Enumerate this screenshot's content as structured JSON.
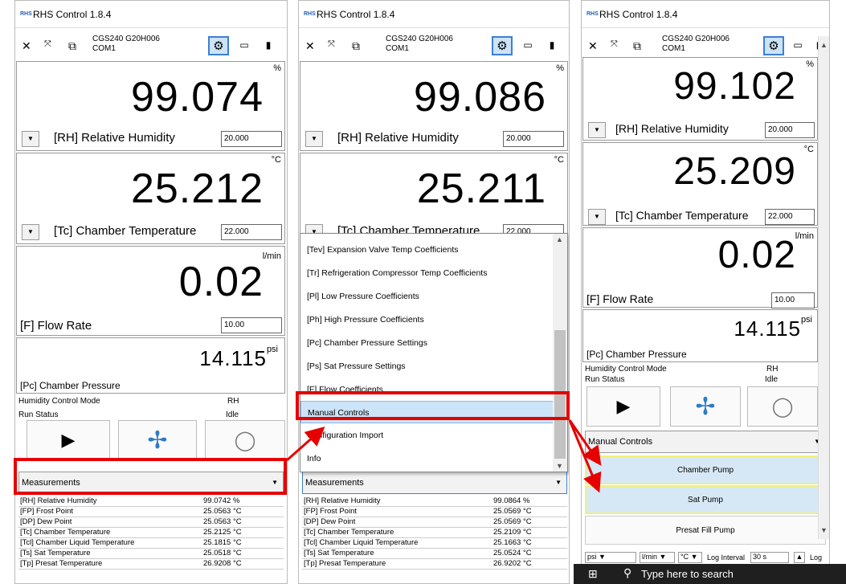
{
  "app": {
    "title": "RHS Control 1.8.4",
    "icon_text": "RHS"
  },
  "device": {
    "name": "CGS240 G20H006",
    "port": "COM1"
  },
  "windows": [
    {
      "rh": {
        "value": "99.074",
        "unit": "%",
        "label": "[RH] Relative Humidity",
        "setpoint": "20.000"
      },
      "tc": {
        "value": "25.212",
        "unit": "°C",
        "label": "[Tc] Chamber Temperature",
        "setpoint": "22.000"
      },
      "flow": {
        "value": "0.02",
        "unit": "l/min",
        "label": "[F] Flow Rate",
        "setpoint": "10.00"
      },
      "pc": {
        "value": "14.115",
        "unit": "psi",
        "label": "[Pc] Chamber Pressure"
      },
      "status": {
        "mode_label": "Humidity Control Mode",
        "mode_value": "RH",
        "run_label": "Run Status",
        "run_value": "Idle"
      },
      "combo": "Measurements",
      "measurements": [
        {
          "name": "[RH] Relative Humidity",
          "value": "99.0742 %"
        },
        {
          "name": "[FP] Frost Point",
          "value": "25.0563 °C"
        },
        {
          "name": "[DP] Dew Point",
          "value": "25.0563 °C"
        },
        {
          "name": "[Tc] Chamber Temperature",
          "value": "25.2125 °C"
        },
        {
          "name": "[Tcl] Chamber Liquid Temperature",
          "value": "25.1815 °C"
        },
        {
          "name": "[Ts] Sat Temperature",
          "value": "25.0518 °C"
        },
        {
          "name": "[Tp] Presat Temperature",
          "value": "26.9208 °C"
        }
      ]
    },
    {
      "rh": {
        "value": "99.086",
        "unit": "%",
        "label": "[RH] Relative Humidity",
        "setpoint": "20.000"
      },
      "tc": {
        "value": "25.211",
        "unit": "°C",
        "label": "[Tc] Chamber Temperature",
        "setpoint": "22.000"
      },
      "combo": "Measurements",
      "menu": [
        "[Tev] Expansion Valve Temp Coefficients",
        "[Tr] Refrigeration Compressor Temp Coefficients",
        "[Pl] Low Pressure Coefficients",
        "[Ph] High Pressure Coefficients",
        "[Pc] Chamber Pressure Settings",
        "[Ps] Sat Pressure Settings",
        "[F] Flow Coefficients",
        "Manual Controls",
        "Configuration Import",
        "Info"
      ],
      "measurements": [
        {
          "name": "[RH] Relative Humidity",
          "value": "99.0864 %"
        },
        {
          "name": "[FP] Frost Point",
          "value": "25.0569 °C"
        },
        {
          "name": "[DP] Dew Point",
          "value": "25.0569 °C"
        },
        {
          "name": "[Tc] Chamber Temperature",
          "value": "25.2109 °C"
        },
        {
          "name": "[Tcl] Chamber Liquid Temperature",
          "value": "25.1663 °C"
        },
        {
          "name": "[Ts] Sat Temperature",
          "value": "25.0524 °C"
        },
        {
          "name": "[Tp] Presat Temperature",
          "value": "26.9202 °C"
        }
      ]
    },
    {
      "rh": {
        "value": "99.102",
        "unit": "%",
        "label": "[RH] Relative Humidity",
        "setpoint": "20.000"
      },
      "tc": {
        "value": "25.209",
        "unit": "°C",
        "label": "[Tc] Chamber Temperature",
        "setpoint": "22.000"
      },
      "flow": {
        "value": "0.02",
        "unit": "l/min",
        "label": "[F] Flow Rate",
        "setpoint": "10.00"
      },
      "pc": {
        "value": "14.115",
        "unit": "psi",
        "label": "[Pc] Chamber Pressure"
      },
      "status": {
        "mode_label": "Humidity Control Mode",
        "mode_value": "RH",
        "run_label": "Run Status",
        "run_value": "Idle"
      },
      "combo": "Manual Controls",
      "pumps": [
        "Chamber Pump",
        "Sat Pump",
        "Presat Fill Pump"
      ],
      "bottom": {
        "pressure_unit": "psi",
        "flow_unit": "l/min",
        "temp_unit": "°C",
        "log_label": "Log Interval",
        "log_value": "30 s",
        "log_button": "Log"
      }
    }
  ],
  "taskbar": {
    "search_placeholder": "Type here to search"
  },
  "colors": {
    "highlight": "#e60000",
    "selection": "#cce4f7",
    "pump_border": "#f0f07a"
  }
}
